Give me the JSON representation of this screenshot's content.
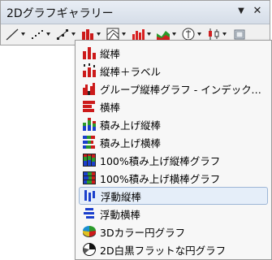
{
  "panel": {
    "title": "2Dグラフギャラリー",
    "dropdown_glyph": "▼",
    "close_glyph": "✕"
  },
  "toolbar": {
    "tools": [
      "line-chart-icon",
      "scatter-chart-icon",
      "line-symbol-chart-icon",
      "bar-chart-icon",
      "contour-chart-icon",
      "3d-bar-chart-icon",
      "area-chart-icon",
      "polar-chart-icon",
      "stock-chart-icon",
      "template-icon"
    ]
  },
  "menu": {
    "items": [
      {
        "label": "縦棒",
        "icon": "column-chart-icon"
      },
      {
        "label": "縦棒＋ラベル",
        "icon": "column-label-chart-icon"
      },
      {
        "label": "グループ縦棒グラフ - インデックスデータ…",
        "icon": "grouped-column-chart-icon"
      },
      {
        "label": "横棒",
        "icon": "horizontal-bar-chart-icon"
      },
      {
        "label": "積み上げ縦棒",
        "icon": "stacked-column-chart-icon"
      },
      {
        "label": "積み上げ横棒",
        "icon": "stacked-bar-chart-icon"
      },
      {
        "label": "100%積み上げ縦棒グラフ",
        "icon": "percent-stacked-column-icon"
      },
      {
        "label": "100%積み上げ横棒グラフ",
        "icon": "percent-stacked-bar-icon"
      },
      {
        "label": "浮動縦棒",
        "icon": "floating-column-icon"
      },
      {
        "label": "浮動横棒",
        "icon": "floating-bar-icon"
      },
      {
        "label": "3Dカラー円グラフ",
        "icon": "3d-color-pie-icon"
      },
      {
        "label": "2D白黒フラットな円グラフ",
        "icon": "2d-bw-pie-icon"
      }
    ],
    "highlighted_index": 8
  }
}
